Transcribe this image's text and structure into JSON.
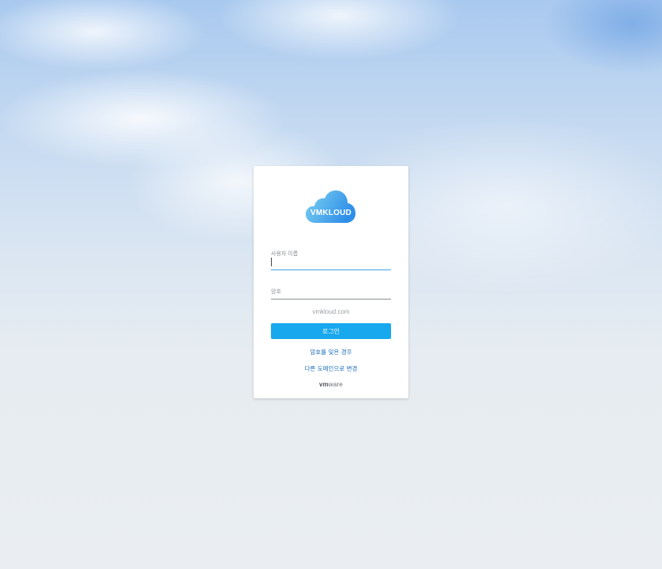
{
  "brand": {
    "logo_text": "VMKLOUD",
    "logo_colors": [
      "#7fd3f2",
      "#2f8fe8"
    ]
  },
  "form": {
    "username_label": "사용자 이름",
    "username_value": "",
    "password_label": "암호",
    "password_value": "",
    "domain": "vmkloud.com",
    "login_button": "로그인",
    "forgot_password_link": "암호를 잊은 경우",
    "change_domain_link": "다른 도메인으로 변경"
  },
  "footer": {
    "vendor_logo_bold": "vm",
    "vendor_logo_rest": "ware"
  },
  "colors": {
    "accent": "#17a8ee",
    "link": "#1b6fb8",
    "active_underline": "#3aa6e6",
    "inactive_underline": "#8c9196"
  }
}
